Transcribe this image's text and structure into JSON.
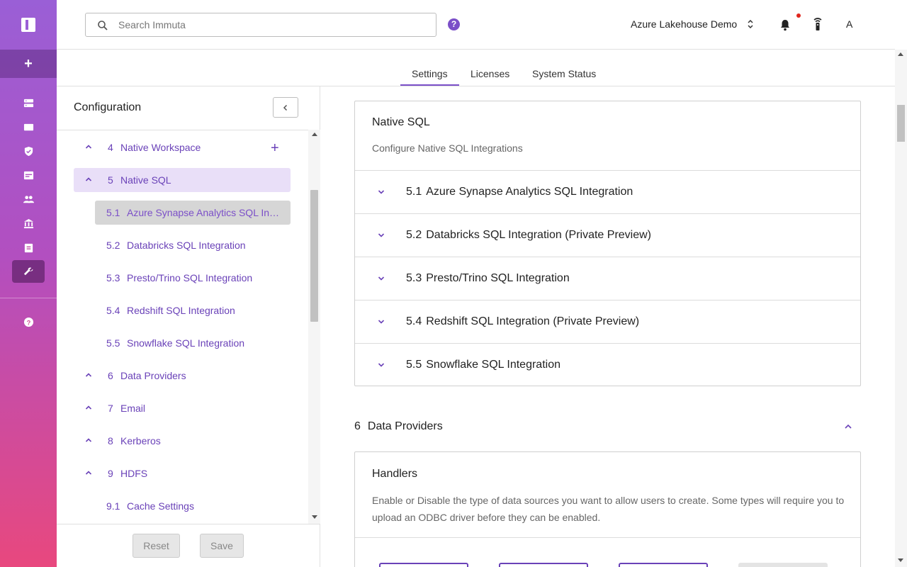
{
  "header": {
    "search_placeholder": "Search Immuta",
    "help_label": "?",
    "tenant": "Azure Lakehouse Demo",
    "avatar": "A"
  },
  "tabs": [
    {
      "label": "Settings",
      "active": true
    },
    {
      "label": "Licenses"
    },
    {
      "label": "System Status"
    }
  ],
  "sidebar": {
    "title": "Configuration",
    "items": [
      {
        "num": "4",
        "label": "Native Workspace",
        "has_add": true
      },
      {
        "num": "5",
        "label": "Native SQL",
        "active": true
      },
      {
        "num": "5.1",
        "label": "Azure Synapse Analytics SQL Integration",
        "sub": true,
        "selected": true
      },
      {
        "num": "5.2",
        "label": "Databricks SQL Integration",
        "sub": true
      },
      {
        "num": "5.3",
        "label": "Presto/Trino SQL Integration",
        "sub": true
      },
      {
        "num": "5.4",
        "label": "Redshift SQL Integration",
        "sub": true
      },
      {
        "num": "5.5",
        "label": "Snowflake SQL Integration",
        "sub": true
      },
      {
        "num": "6",
        "label": "Data Providers"
      },
      {
        "num": "7",
        "label": "Email"
      },
      {
        "num": "8",
        "label": "Kerberos"
      },
      {
        "num": "9",
        "label": "HDFS"
      },
      {
        "num": "9.1",
        "label": "Cache Settings",
        "sub": true
      }
    ],
    "reset_label": "Reset",
    "save_label": "Save"
  },
  "main": {
    "native_sql": {
      "title": "Native SQL",
      "subtitle": "Configure Native SQL Integrations",
      "rows": [
        {
          "num": "5.1",
          "label": "Azure Synapse Analytics SQL Integration"
        },
        {
          "num": "5.2",
          "label": "Databricks SQL Integration (Private Preview)"
        },
        {
          "num": "5.3",
          "label": "Presto/Trino SQL Integration"
        },
        {
          "num": "5.4",
          "label": "Redshift SQL Integration (Private Preview)"
        },
        {
          "num": "5.5",
          "label": "Snowflake SQL Integration"
        }
      ]
    },
    "data_providers": {
      "num": "6",
      "title": "Data Providers",
      "handlers_title": "Handlers",
      "handlers_desc": "Enable or Disable the type of data sources you want to allow users to create. Some types will require you to upload an ODBC driver before they can be enabled."
    }
  },
  "colors": {
    "accent": "#7b4fc8",
    "nav_text": "#6a42b8",
    "active_bg": "#e9dff8",
    "rail_top": "#9a5fd6",
    "rail_bottom": "#e8487e"
  }
}
